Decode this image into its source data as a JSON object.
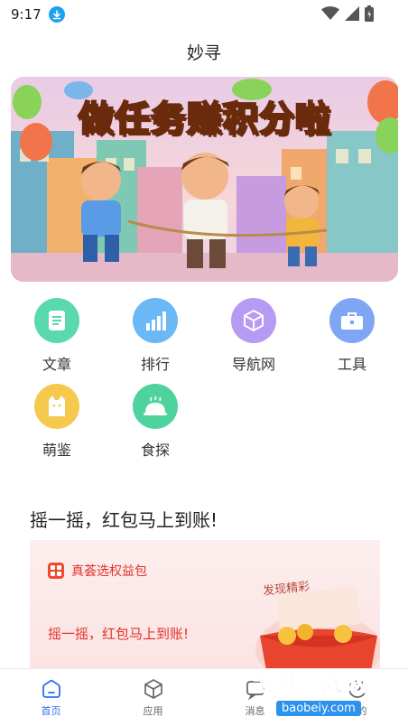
{
  "status_bar": {
    "time": "9:17"
  },
  "app": {
    "title": "妙寻"
  },
  "banner": {
    "headline": "做任务赚积分啦"
  },
  "grid": [
    {
      "label": "文章",
      "icon": "article-icon",
      "color": "#5ad8b0"
    },
    {
      "label": "排行",
      "icon": "ranking-icon",
      "color": "#6ab8f6"
    },
    {
      "label": "导航网",
      "icon": "navigation-cube-icon",
      "color": "#b79af2"
    },
    {
      "label": "工具",
      "icon": "toolbox-icon",
      "color": "#7ea6f4"
    },
    {
      "label": "萌鉴",
      "icon": "cat-icon",
      "color": "#f6c94e"
    },
    {
      "label": "食探",
      "icon": "food-cloche-icon",
      "color": "#4fd39e"
    }
  ],
  "section": {
    "title": "摇一摇，红包马上到账!"
  },
  "promo": {
    "brand": "真荟选权益包",
    "text": "摇一摇，红包马上到账!",
    "tag": "发现精彩"
  },
  "watermark": {
    "title": "宝贝游戏网",
    "url": "baobeiy.com"
  },
  "tabs": [
    {
      "label": "首页",
      "icon": "home-icon",
      "active": true
    },
    {
      "label": "应用",
      "icon": "apps-cube-icon",
      "active": false
    },
    {
      "label": "消息",
      "icon": "message-icon",
      "active": false
    },
    {
      "label": "我的",
      "icon": "profile-icon",
      "active": false
    }
  ],
  "colors": {
    "accent": "#2f6ff0",
    "promo_red": "#e0322a"
  }
}
